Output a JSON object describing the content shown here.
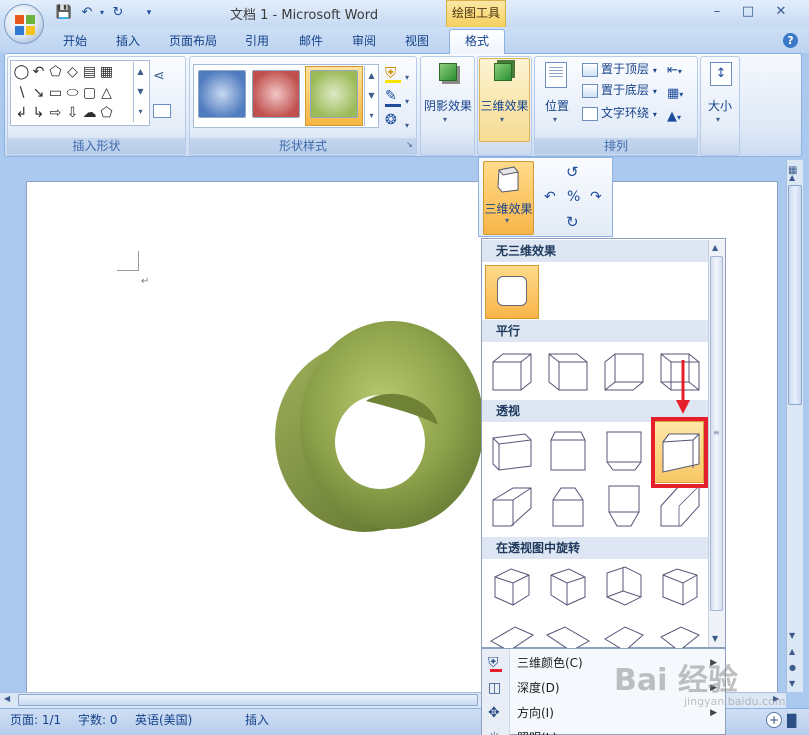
{
  "window": {
    "title": "文档 1 - Microsoft Word",
    "context_tab_title": "绘图工具"
  },
  "tabs": [
    {
      "label": "开始"
    },
    {
      "label": "插入"
    },
    {
      "label": "页面布局"
    },
    {
      "label": "引用"
    },
    {
      "label": "邮件"
    },
    {
      "label": "审阅"
    },
    {
      "label": "视图"
    },
    {
      "label": "格式"
    }
  ],
  "ribbon": {
    "groups": {
      "insert_shapes": "插入形状",
      "shape_styles": "形状样式",
      "arrange": "排列"
    },
    "shadow_effects": "阴影效果",
    "three_d_effects": "三维效果",
    "position": "位置",
    "bring_to_front": "置于顶层",
    "send_to_back": "置于底层",
    "text_wrapping": "文字环绕",
    "size": "大小",
    "style_colors": [
      "#4f7bbf",
      "#c0504d",
      "#9bbb59"
    ]
  },
  "popup": {
    "three_d_effects": "三维效果"
  },
  "gallery": {
    "headers": [
      "无三维效果",
      "平行",
      "透视",
      "在透视图中旋转"
    ],
    "accent": "#f8b54a",
    "highlight": "#e6202a"
  },
  "menu": [
    {
      "label": "三维颜色(C)",
      "icon": "paint-bucket-icon"
    },
    {
      "label": "深度(D)",
      "icon": "depth-icon"
    },
    {
      "label": "方向(I)",
      "icon": "direction-icon"
    },
    {
      "label": "照明(L)",
      "icon": "lighting-icon"
    }
  ],
  "status": {
    "page": "页面: 1/1",
    "words": "字数: 0",
    "language": "英语(美国)",
    "mode": "插入"
  },
  "shape": {
    "color": "#8da24a"
  },
  "watermark": "Bai 经验"
}
